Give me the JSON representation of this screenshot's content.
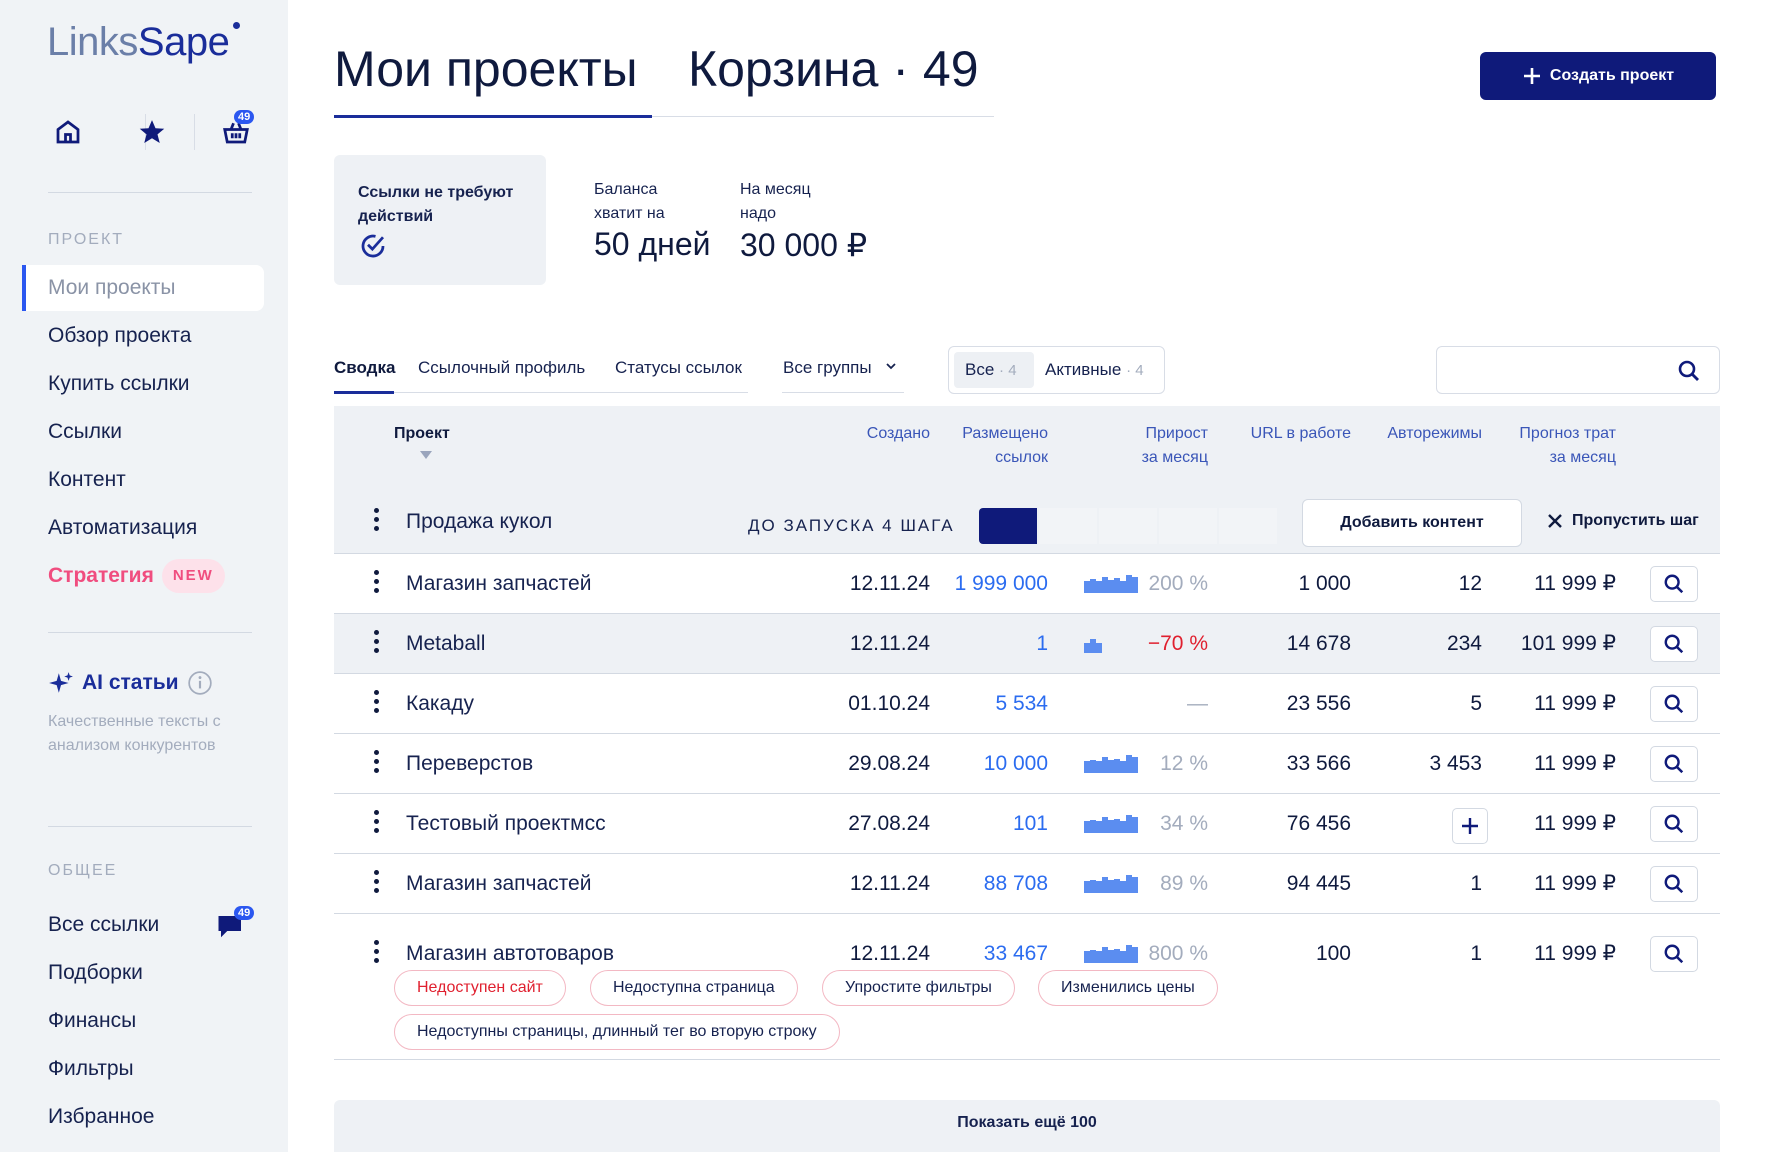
{
  "sidebar": {
    "logo_left": "Links",
    "logo_right": "Sape",
    "basket_count": "49",
    "section_project": "ПРОЕКТ",
    "items": [
      {
        "label": "Мои проекты"
      },
      {
        "label": "Обзор проекта"
      },
      {
        "label": "Купить ссылки"
      },
      {
        "label": "Ссылки"
      },
      {
        "label": "Контент"
      },
      {
        "label": "Автоматизация"
      },
      {
        "label": "Стратегия",
        "badge": "NEW"
      }
    ],
    "ai": {
      "title": "AI статьи",
      "desc": "Качественные тексты с анализом конкурентов"
    },
    "section_common": "ОБЩЕЕ",
    "common_items": [
      {
        "label": "Все ссылки",
        "badge": "49"
      },
      {
        "label": "Подборки"
      },
      {
        "label": "Финансы"
      },
      {
        "label": "Фильтры"
      },
      {
        "label": "Избранное"
      }
    ]
  },
  "header": {
    "title": "Мои проекты",
    "basket_title": "Корзина · 49",
    "create_button": "Создать проект"
  },
  "summary": {
    "status": "Ссылки не требуют действий",
    "balance_label": "Баланса хватит на",
    "balance_value": "50 дней",
    "month_label": "На месяц надо",
    "month_value": "30 000 ₽"
  },
  "tabs": [
    "Сводка",
    "Ссылочный профиль",
    "Статусы ссылок"
  ],
  "groups_select": "Все группы",
  "filter": {
    "all_label": "Все",
    "all_count": "· 4",
    "active_label": "Активные",
    "active_count": "· 4"
  },
  "table": {
    "headers": {
      "project": "Проект",
      "created": "Создано",
      "placed_1": "Размещено",
      "placed_2": "ссылок",
      "growth_1": "Прирост",
      "growth_2": "за месяц",
      "urls": "URL в работе",
      "auto": "Авторежимы",
      "forecast_1": "Прогноз трат",
      "forecast_2": "за месяц"
    },
    "onboarding": {
      "name": "Продажа кукол",
      "steps_label": "ДО ЗАПУСКА 4 ШАГА",
      "steps_total": 5,
      "steps_done": 1,
      "add_content": "Добавить контент",
      "skip": "Пропустить шаг"
    },
    "rows": [
      {
        "name": "Магазин запчастей",
        "created": "12.11.24",
        "placed": "1 999 000",
        "growth": "200 %",
        "urls": "1 000",
        "auto": "12",
        "forecast": "11 999 ₽"
      },
      {
        "name": "Metaball",
        "created": "12.11.24",
        "placed": "1",
        "growth": "−70 %",
        "urls": "14 678",
        "auto": "234",
        "forecast": "101 999 ₽"
      },
      {
        "name": "Какаду",
        "created": "01.10.24",
        "placed": "5 534",
        "growth": "—",
        "urls": "23 556",
        "auto": "5",
        "forecast": "11 999 ₽"
      },
      {
        "name": "Переверстов",
        "created": "29.08.24",
        "placed": "10 000",
        "growth": "12 %",
        "urls": "33 566",
        "auto": "3 453",
        "forecast": "11 999 ₽"
      },
      {
        "name": "Тестовый проектмсс",
        "created": "27.08.24",
        "placed": "101",
        "growth": "34 %",
        "urls": "76 456",
        "auto": "",
        "forecast": "11 999 ₽"
      },
      {
        "name": "Магазин запчастей",
        "created": "12.11.24",
        "placed": "88 708",
        "growth": "89 %",
        "urls": "94 445",
        "auto": "1",
        "forecast": "11 999 ₽"
      },
      {
        "name": "Магазин автотоваров",
        "created": "12.11.24",
        "placed": "33 467",
        "growth": "800 %",
        "urls": "100",
        "auto": "1",
        "forecast": "11 999 ₽"
      }
    ],
    "tags": [
      "Недоступен сайт",
      "Недоступна страница",
      "Упростите фильтры",
      "Изменились цены",
      "Недоступны страницы, длинный тег во вторую строку"
    ]
  },
  "show_more": "Показать ещё 100",
  "colors": {
    "brand": "#0f1a7a",
    "accent": "#2b57f0",
    "link": "#2b6cf0",
    "negative": "#e0202f",
    "pink": "#f04d7f"
  }
}
